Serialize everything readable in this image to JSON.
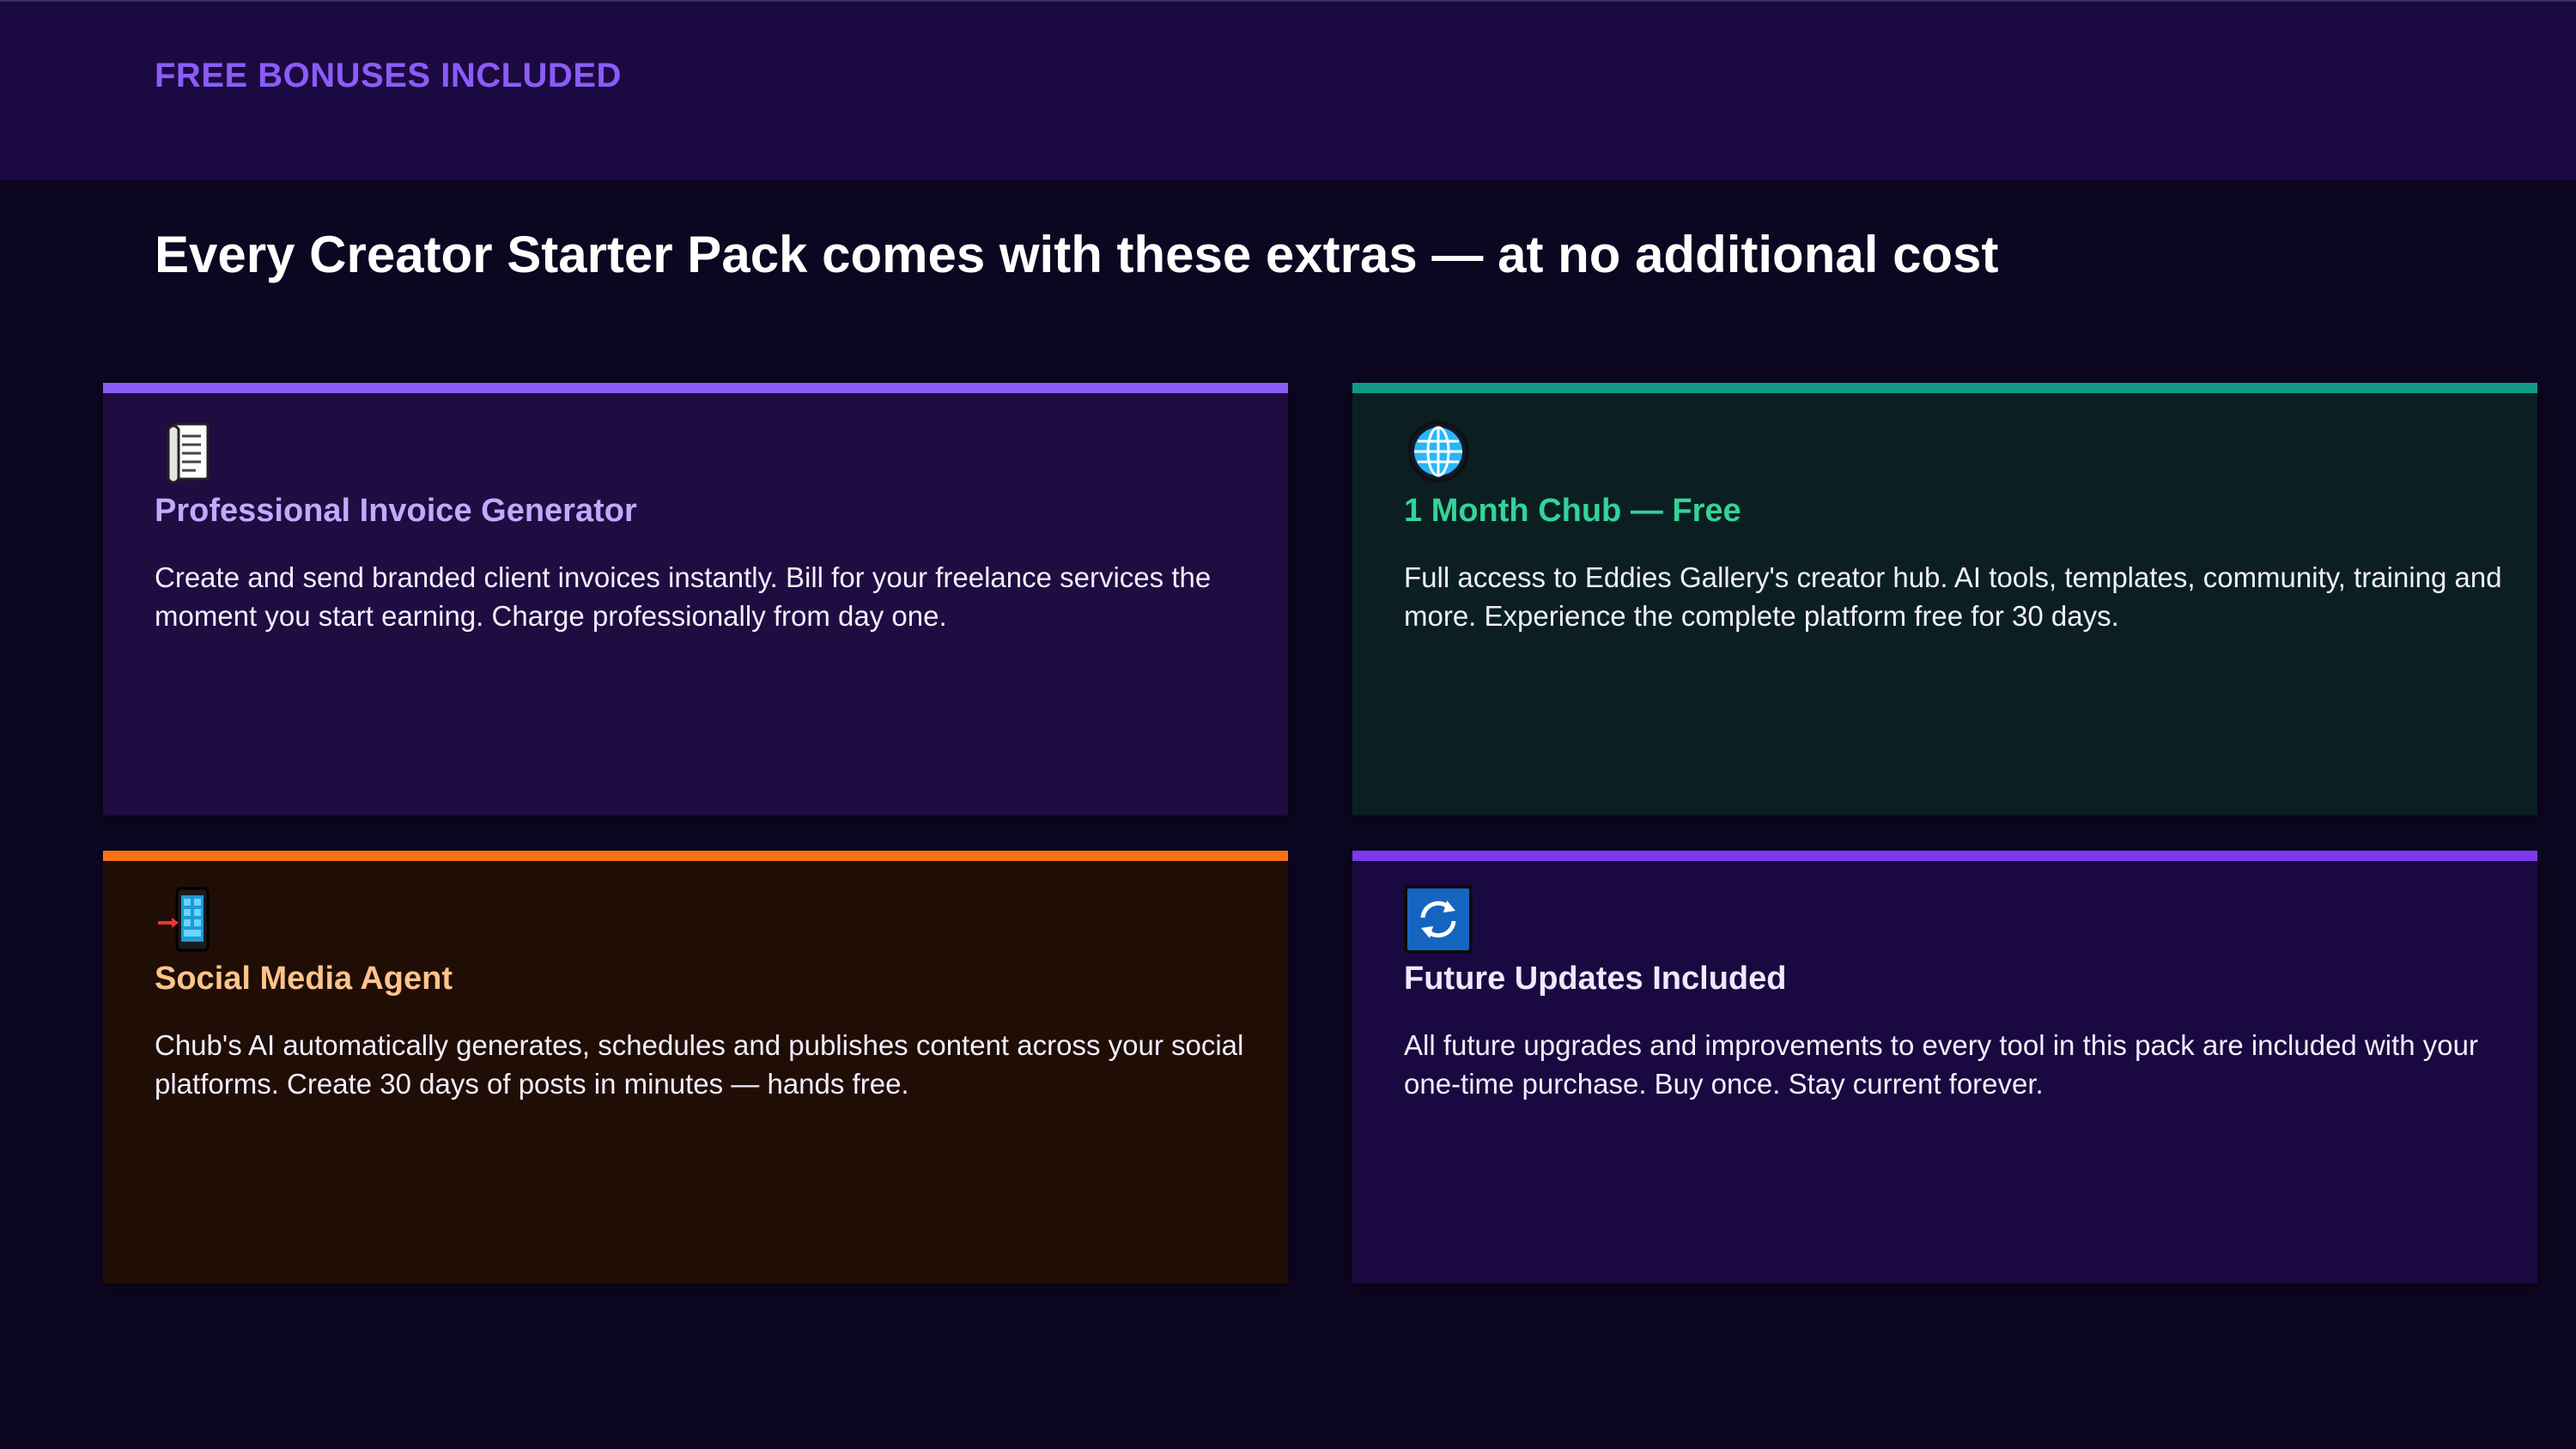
{
  "header": {
    "label": "FREE BONUSES INCLUDED"
  },
  "headline": "Every Creator Starter Pack comes with these extras — at no additional cost",
  "cards": [
    {
      "icon": "receipt-icon",
      "title": "Professional Invoice Generator",
      "description": "Create and send branded client invoices instantly. Bill for your freelance services the moment you start earning. Charge professionally from day one.",
      "accent": "#8b5cf6"
    },
    {
      "icon": "globe-icon",
      "title": "1 Month Chub — Free",
      "description": "Full access to Eddies Gallery's creator hub. AI tools, templates, community, training and more. Experience the complete platform free for 30 days.",
      "accent": "#0f9b86"
    },
    {
      "icon": "mobile-phone-arrow-icon",
      "title": "Social Media Agent",
      "description": "Chub's AI automatically generates, schedules and publishes content across your social platforms. Create 30 days of posts in minutes — hands free.",
      "accent": "#f97316"
    },
    {
      "icon": "refresh-icon",
      "title": "Future Updates Included",
      "description": "All future upgrades and improvements to every tool in this pack are included with your one-time purchase. Buy once. Stay current forever.",
      "accent": "#7c3aed"
    }
  ]
}
